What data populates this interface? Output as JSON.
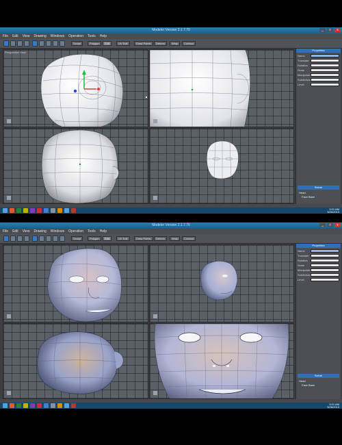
{
  "window_title": "Modeler Version 2.1.7.70",
  "menus": [
    "File",
    "Edit",
    "View",
    "Drawing",
    "Windows",
    "Operation",
    "Tools",
    "Help"
  ],
  "tabs": [
    "Sculpt",
    "Polygon",
    "Edit",
    "UV Edit",
    "Sculpt",
    "Draw Points",
    "Deform",
    "Wrap",
    "Contour"
  ],
  "window_controls": [
    "_",
    "□",
    "x"
  ],
  "viewports": {
    "perspective": "Perspective View",
    "left": "Left View",
    "front": "Front View",
    "top": "Top View"
  },
  "panel": {
    "header": "Properties",
    "rows": [
      {
        "key": "Name",
        "value": ""
      },
      {
        "key": "Translate",
        "value": ""
      },
      {
        "key": "Rotation",
        "value": ""
      },
      {
        "key": "Scale",
        "value": ""
      },
      {
        "key": "Manipulator",
        "value": ""
      },
      {
        "key": "Subdivision",
        "value": ""
      },
      {
        "key": "Level",
        "value": ""
      }
    ],
    "scene_header": "Scene",
    "scene_items": [
      "Head",
      "Face Base"
    ]
  },
  "taskbar_time": "9:21 AM",
  "taskbar_date": "3/26/2013",
  "colors": {
    "titlebar": "#2a7fb0",
    "taskbar": "#17466b",
    "viewport_bg": "#5b5f66",
    "accent": "#2f6fb8"
  }
}
